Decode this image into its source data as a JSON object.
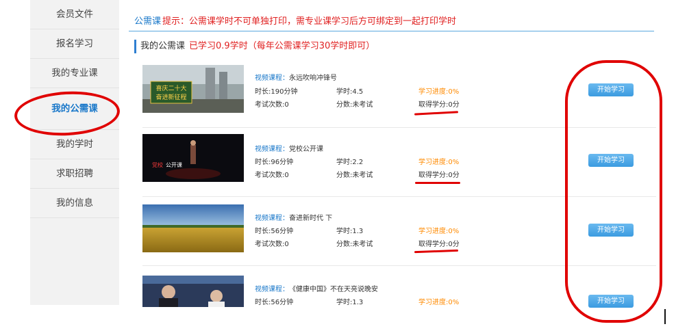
{
  "sidebar": {
    "items": [
      {
        "label": "会员文件"
      },
      {
        "label": "报名学习"
      },
      {
        "label": "我的专业课"
      },
      {
        "label": "我的公需课"
      },
      {
        "label": "我的学时"
      },
      {
        "label": "求职招聘"
      },
      {
        "label": "我的信息"
      }
    ]
  },
  "notice": {
    "tag": "公需课",
    "tip": "提示：公需课学时不可单独打印，需专业课学习后方可绑定到一起打印学时"
  },
  "section": {
    "title": "我的公需课",
    "stat": "已学习0.9学时（每年公需课学习30学时即可）"
  },
  "courses": [
    {
      "type_label": "视频课程：",
      "name": "永远吹响冲锋号",
      "duration": "时长:190分钟",
      "hours": "学时:4.5",
      "progress": "学习进度:0%",
      "exams": "考试次数:0",
      "score": "分数:未考试",
      "credit": "取得学分:0分",
      "button": "开始学习",
      "thumb_text": [
        "喜庆二十大",
        "奋进新征程"
      ]
    },
    {
      "type_label": "视频课程：",
      "name": "党校公开课",
      "duration": "时长:96分钟",
      "hours": "学时:2.2",
      "progress": "学习进度:0%",
      "exams": "考试次数:0",
      "score": "分数:未考试",
      "credit": "取得学分:0分",
      "button": "开始学习",
      "thumb_text": [
        "党校",
        "公开课"
      ]
    },
    {
      "type_label": "视频课程：",
      "name": "奋进新时代 下",
      "duration": "时长:56分钟",
      "hours": "学时:1.3",
      "progress": "学习进度:0%",
      "exams": "考试次数:0",
      "score": "分数:未考试",
      "credit": "取得学分:0分",
      "button": "开始学习"
    },
    {
      "type_label": "视频课程：",
      "name": "《健康中国》不在天亮说晚安",
      "duration": "时长:56分钟",
      "hours": "学时:1.3",
      "progress": "学习进度:0%",
      "button": "开始学习"
    }
  ],
  "colors": {
    "accent_blue": "#1877c9",
    "warning_red": "#e02020",
    "progress_orange": "#ff8a00",
    "annotation_red": "#e00000"
  }
}
